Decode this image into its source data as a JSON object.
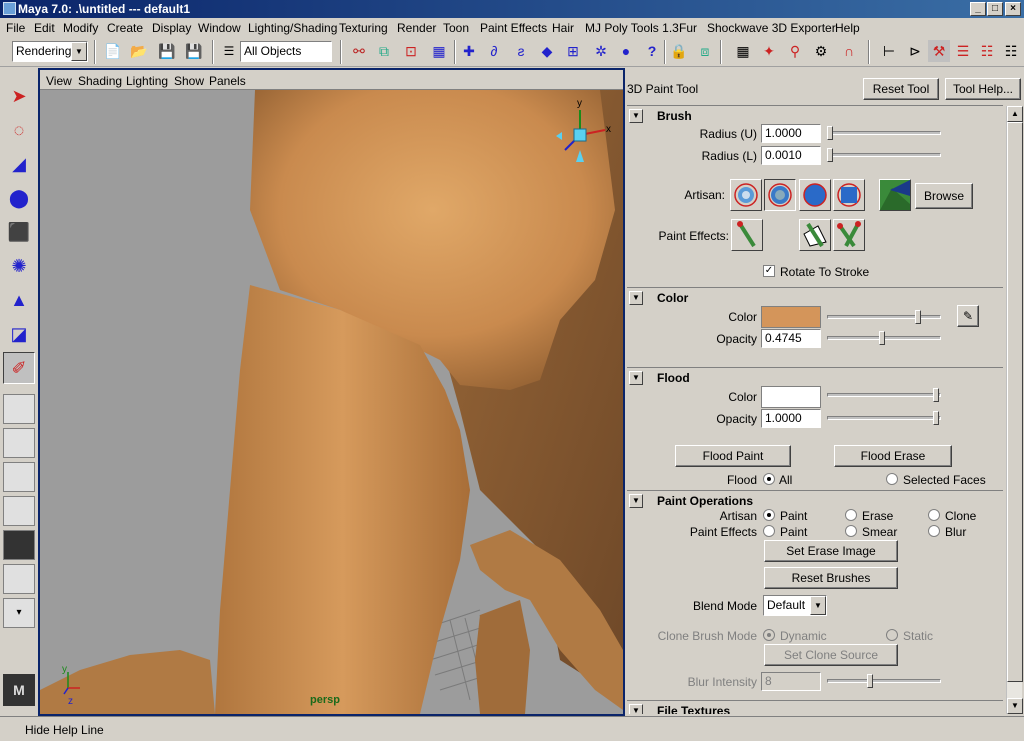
{
  "window": {
    "title": "Maya 7.0: .\\untitled   ---   default1",
    "minimize": "_",
    "maximize": "□",
    "close": "×"
  },
  "menubar": [
    "File",
    "Edit",
    "Modify",
    "Create",
    "Display",
    "Window",
    "Lighting/Shading",
    "Texturing",
    "Render",
    "Toon",
    "Paint Effects",
    "Hair",
    "MJ Poly Tools 1.3",
    "Fur",
    "Shockwave 3D Exporter",
    "Help"
  ],
  "toolbar": {
    "menu_set": "Rendering",
    "selection_field": "All Objects"
  },
  "viewport": {
    "menu": [
      "View",
      "Shading",
      "Lighting",
      "Show",
      "Panels"
    ],
    "camera_label": "persp",
    "axis": {
      "x": "x",
      "y": "y",
      "z": "z"
    }
  },
  "panel": {
    "title": "3D Paint Tool",
    "reset_tool": "Reset Tool",
    "tool_help": "Tool Help...",
    "brush": {
      "header": "Brush",
      "radius_u_label": "Radius (U)",
      "radius_u": "1.0000",
      "radius_u_fraction": 0.02,
      "radius_l_label": "Radius (L)",
      "radius_l": "0.0010",
      "radius_l_fraction": 0.01,
      "artisan_label": "Artisan:",
      "browse": "Browse",
      "paint_effects_label": "Paint Effects:",
      "rotate_to_stroke": "Rotate To Stroke",
      "rotate_to_stroke_checked": true
    },
    "color": {
      "header": "Color",
      "color_label": "Color",
      "swatch": "#d4955a",
      "opacity_label": "Opacity",
      "opacity": "0.4745"
    },
    "flood": {
      "header": "Flood",
      "color_label": "Color",
      "swatch": "#ffffff",
      "opacity_label": "Opacity",
      "opacity": "1.0000",
      "flood_paint": "Flood Paint",
      "flood_erase": "Flood Erase",
      "flood_label": "Flood",
      "all": "All",
      "selected_faces": "Selected Faces"
    },
    "paint_operations": {
      "header": "Paint Operations",
      "artisan_label": "Artisan",
      "artisan_paint": "Paint",
      "artisan_erase": "Erase",
      "artisan_clone": "Clone",
      "pe_label": "Paint Effects",
      "pe_paint": "Paint",
      "pe_smear": "Smear",
      "pe_blur": "Blur",
      "set_erase_image": "Set Erase Image",
      "reset_brushes": "Reset Brushes",
      "blend_mode_label": "Blend Mode",
      "blend_mode": "Default",
      "clone_brush_mode_label": "Clone Brush Mode",
      "dynamic": "Dynamic",
      "static": "Static",
      "set_clone_source": "Set Clone Source",
      "blur_intensity_label": "Blur Intensity",
      "blur_intensity": "8"
    },
    "file_textures": {
      "header": "File Textures"
    }
  },
  "helpline": {
    "text": "Hide Help Line"
  }
}
